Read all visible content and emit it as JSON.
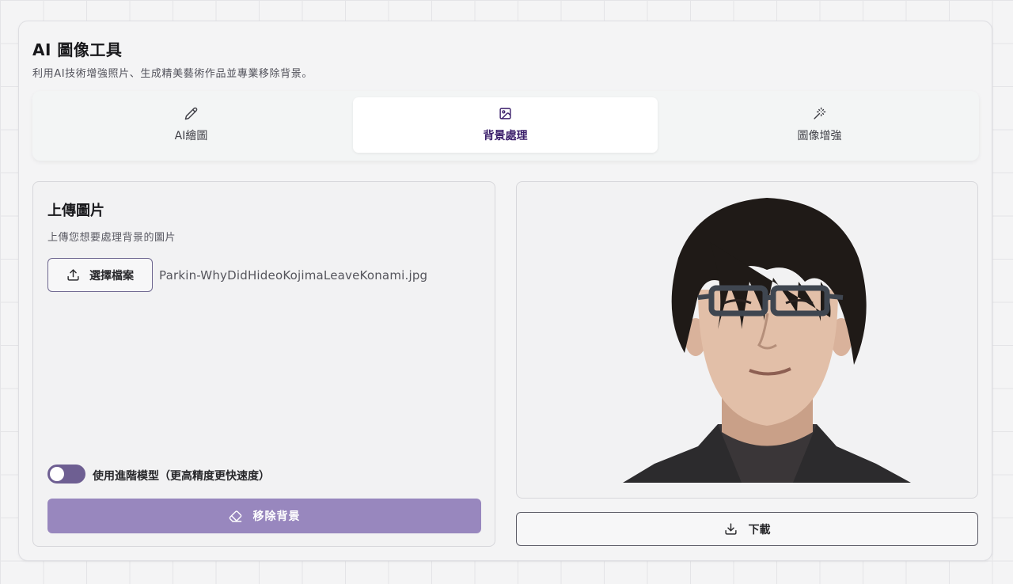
{
  "header": {
    "title": "AI 圖像工具",
    "subtitle": "利用AI技術增強照片、生成精美藝術作品並專業移除背景。"
  },
  "tabs": [
    {
      "label": "AI繪圖",
      "icon": "pencil-icon",
      "active": false
    },
    {
      "label": "背景處理",
      "icon": "image-icon",
      "active": true
    },
    {
      "label": "圖像增強",
      "icon": "magic-wand-icon",
      "active": false
    }
  ],
  "upload": {
    "title": "上傳圖片",
    "description": "上傳您想要處理背景的圖片",
    "choose_label": "選擇檔案",
    "file_name": "Parkin-WhyDidHideoKojimaLeaveKonami.jpg",
    "toggle_label": "使用進階模型（更高精度更快速度）",
    "toggle_on": true,
    "remove_label": "移除背景"
  },
  "result": {
    "download_label": "下載"
  },
  "colors": {
    "accent": "#6e5f92",
    "active_tab_text": "#3b1f6b",
    "remove_button": "#9887be"
  }
}
